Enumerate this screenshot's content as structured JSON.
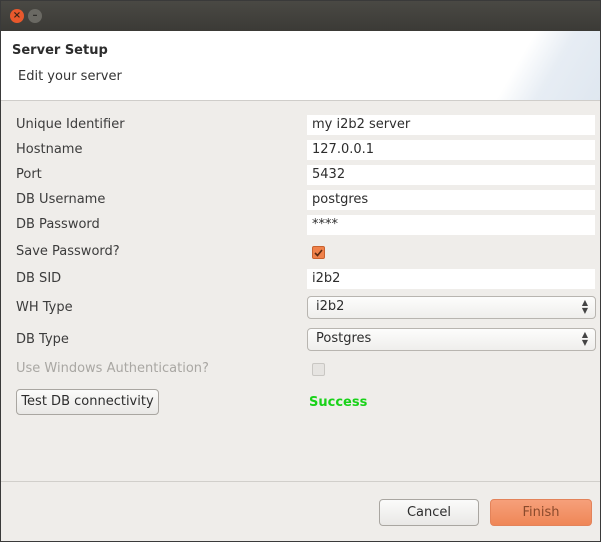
{
  "titlebar": {
    "close_icon": "close-icon",
    "minimize_icon": "minimize-icon"
  },
  "header": {
    "title": "Server Setup",
    "subtitle": "Edit your server"
  },
  "form": {
    "unique_identifier": {
      "label": "Unique Identifier",
      "value": "my i2b2 server"
    },
    "hostname": {
      "label": "Hostname",
      "value": "127.0.0.1"
    },
    "port": {
      "label": "Port",
      "value": "5432"
    },
    "db_username": {
      "label": "DB Username",
      "value": "postgres"
    },
    "db_password": {
      "label": "DB Password",
      "value": "****"
    },
    "save_password": {
      "label": "Save Password?",
      "checked": true
    },
    "db_sid": {
      "label": "DB SID",
      "value": "i2b2"
    },
    "wh_type": {
      "label": "WH Type",
      "value": "i2b2"
    },
    "db_type": {
      "label": "DB Type",
      "value": "Postgres"
    },
    "windows_auth": {
      "label": "Use Windows Authentication?",
      "checked": false,
      "disabled": true
    }
  },
  "test": {
    "button_label": "Test DB connectivity",
    "status": "Success",
    "status_color": "#19d219"
  },
  "footer": {
    "cancel_label": "Cancel",
    "finish_label": "Finish"
  },
  "colors": {
    "accent": "#f0824b",
    "titlebar": "#3b3a36",
    "background": "#efedea"
  }
}
